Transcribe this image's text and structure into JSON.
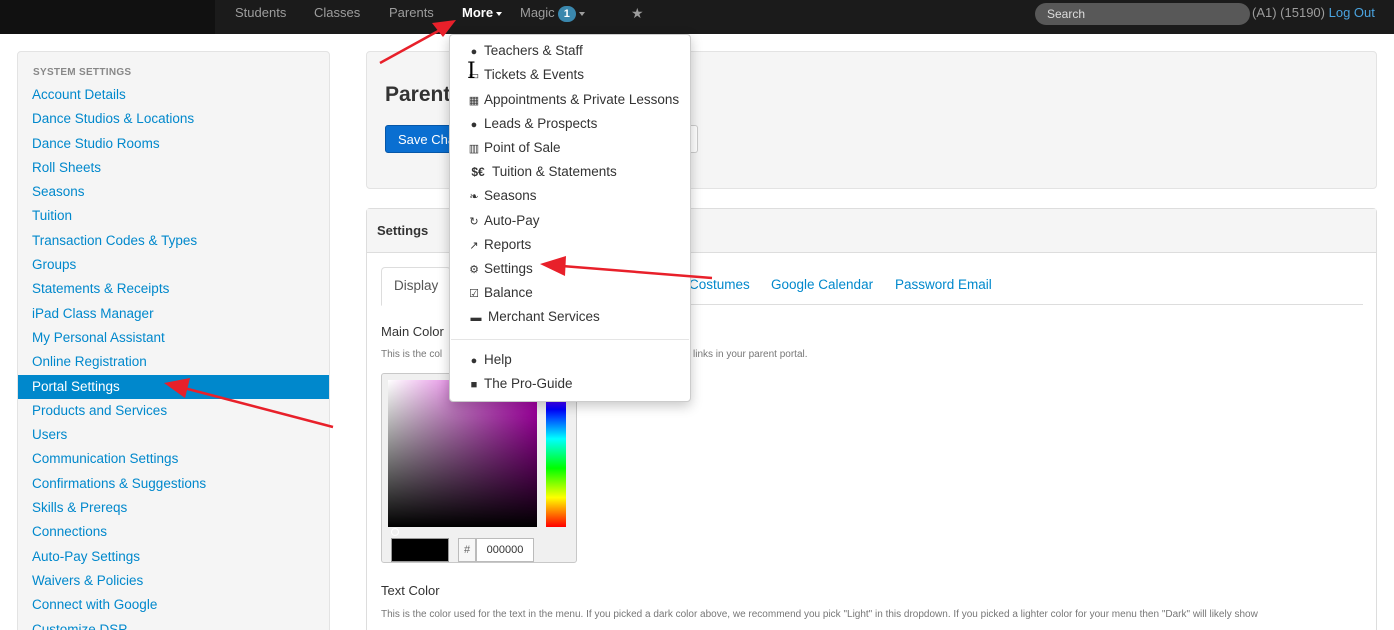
{
  "nav": {
    "items": [
      {
        "label": "Students"
      },
      {
        "label": "Classes"
      },
      {
        "label": "Parents"
      },
      {
        "label": "More"
      },
      {
        "label": "Magic",
        "badge": "1"
      }
    ],
    "search_placeholder": "Search",
    "user_text": "(A1) (15190)",
    "logout_label": "Log Out"
  },
  "sidebar": {
    "header": "SYSTEM SETTINGS",
    "items": [
      "Account Details",
      "Dance Studios & Locations",
      "Dance Studio Rooms",
      "Roll Sheets",
      "Seasons",
      "Tuition",
      "Transaction Codes & Types",
      "Groups",
      "Statements & Receipts",
      "iPad Class Manager",
      "My Personal Assistant",
      "Online Registration",
      "Portal Settings",
      "Products and Services",
      "Users",
      "Communication Settings",
      "Confirmations & Suggestions",
      "Skills & Prereqs",
      "Connections",
      "Auto-Pay Settings",
      "Waivers & Policies",
      "Connect with Google",
      "Customize DSP"
    ],
    "active_index": 12
  },
  "main": {
    "page_title": "Parent",
    "save_label": "Save Cha",
    "panel_title": "Settings",
    "tabs": [
      "Display",
      "Costumes",
      "Google Calendar",
      "Password Email"
    ],
    "main_color_label": "Main Color",
    "main_color_help_left": "This is the col",
    "main_color_help_right": "links in your parent portal.",
    "hex_prefix": "#",
    "hex_value": "000000",
    "text_color_label": "Text Color",
    "text_color_help": "This is the color used for the text in the menu. If you picked a dark color above, we recommend you pick \"Light\" in this dropdown. If you picked a lighter color for your menu then \"Dark\" will likely show"
  },
  "dropdown": {
    "items": [
      {
        "icon": "users-icon",
        "label": "Teachers & Staff"
      },
      {
        "icon": "ticket-icon",
        "label": "Tickets & Events"
      },
      {
        "icon": "calendar-icon",
        "label": "Appointments & Private Lessons"
      },
      {
        "icon": "map-marker-icon",
        "label": "Leads & Prospects"
      },
      {
        "icon": "barcode-icon",
        "label": "Point of Sale"
      },
      {
        "icon": "dollar-euro-icon",
        "label": "Tuition & Statements"
      },
      {
        "icon": "leaf-icon",
        "label": "Seasons"
      },
      {
        "icon": "refresh-icon",
        "label": "Auto-Pay"
      },
      {
        "icon": "line-chart-icon",
        "label": "Reports"
      },
      {
        "icon": "gears-icon",
        "label": "Settings"
      },
      {
        "icon": "check-square-icon",
        "label": "Balance"
      },
      {
        "icon": "visa-card-icon",
        "label": "Merchant Services"
      }
    ],
    "footer_items": [
      {
        "icon": "info-circle-icon",
        "label": "Help"
      },
      {
        "icon": "book-icon",
        "label": "The Pro-Guide"
      }
    ]
  },
  "colors": {
    "topbar": "#1b1b1b",
    "link": "#0088cc",
    "active": "#0088cc",
    "arrow": "#e8202a",
    "button": "#0a6fd1"
  }
}
